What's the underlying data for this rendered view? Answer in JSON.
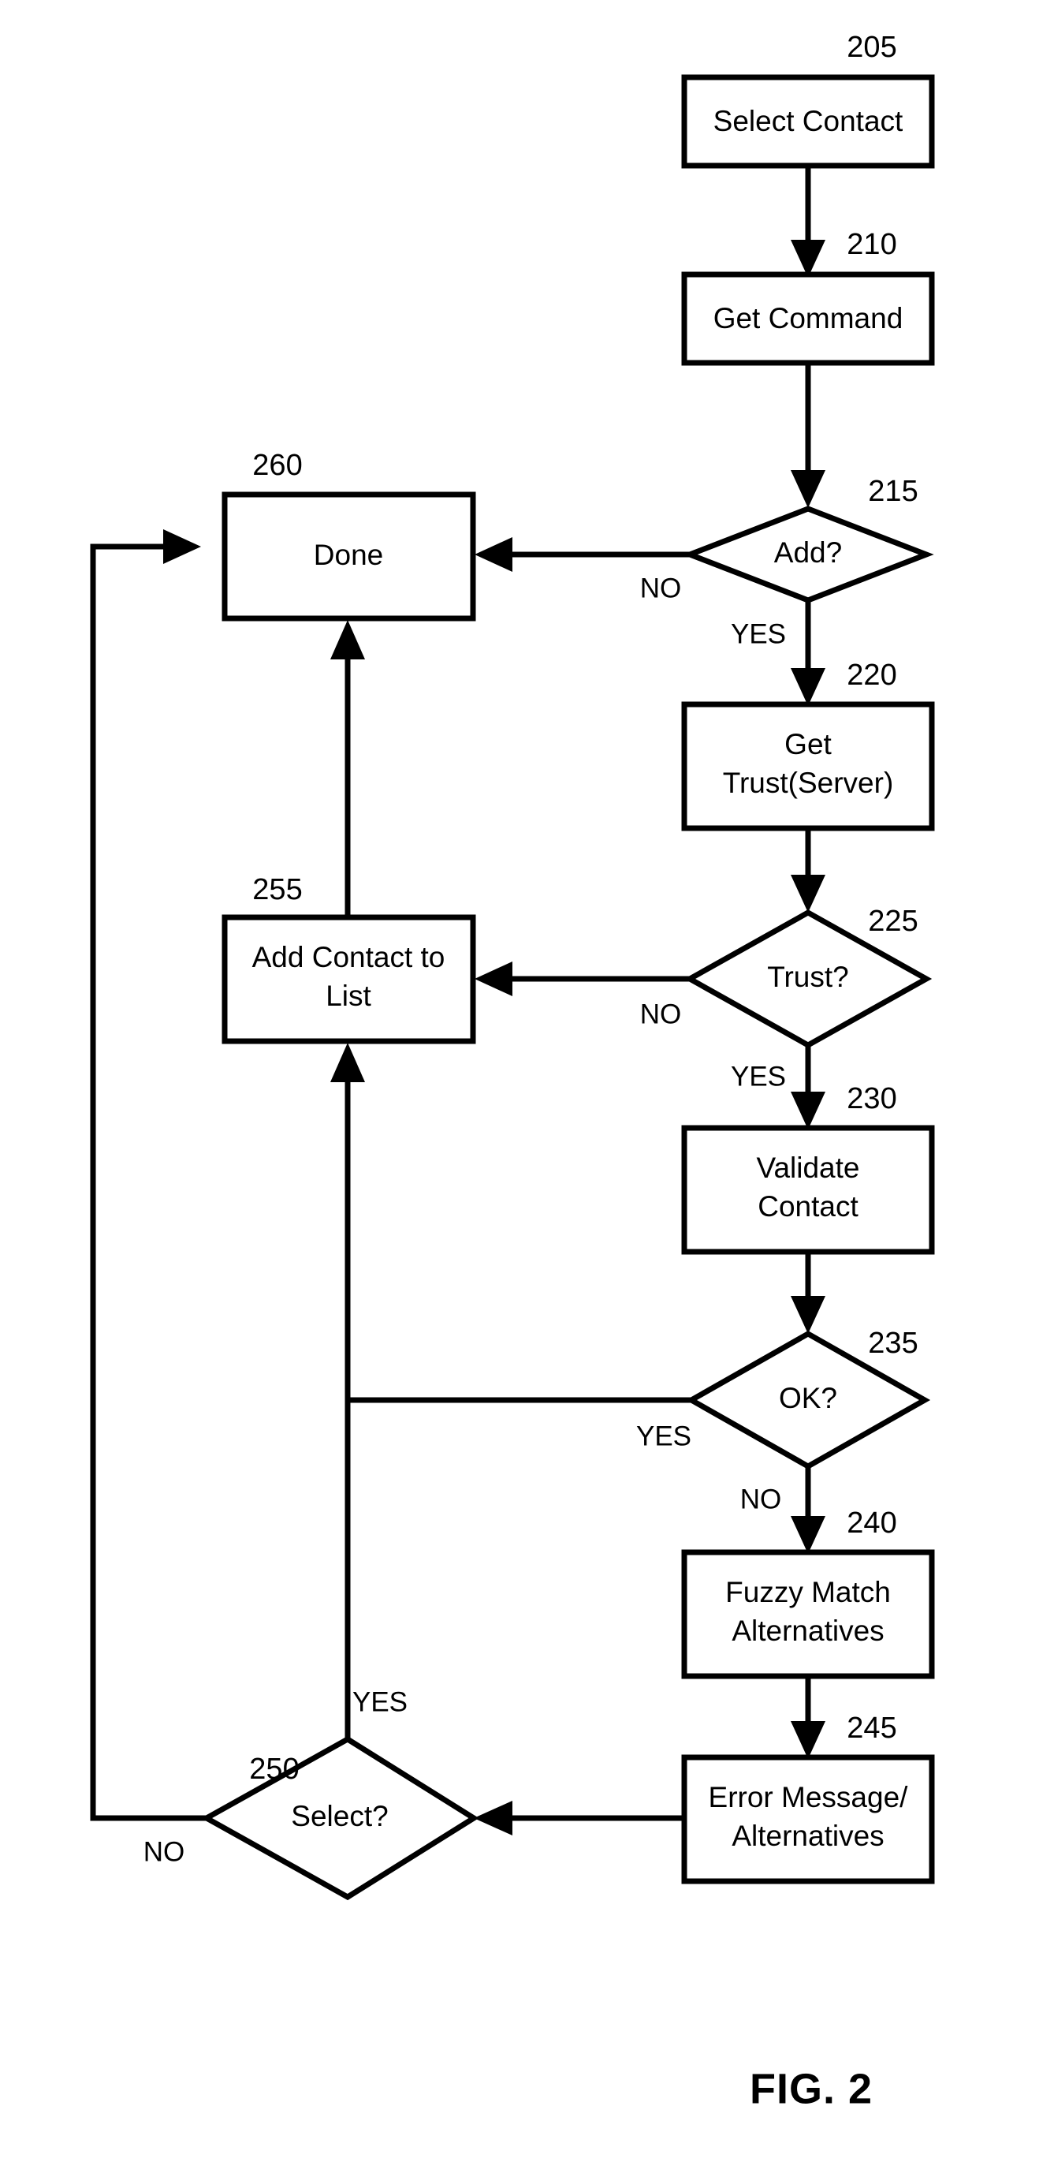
{
  "figure": {
    "caption": "FIG. 2",
    "background_color": "#ffffff",
    "line_color": "#000000"
  },
  "nodes": [
    {
      "ref": "205",
      "shape": "process",
      "label_line1": "Select Contact",
      "label_line2": ""
    },
    {
      "ref": "210",
      "shape": "process",
      "label_line1": "Get Command",
      "label_line2": ""
    },
    {
      "ref": "215",
      "shape": "decision",
      "label_line1": "Add?",
      "label_line2": ""
    },
    {
      "ref": "220",
      "shape": "process",
      "label_line1": "Get",
      "label_line2": "Trust(Server)"
    },
    {
      "ref": "225",
      "shape": "decision",
      "label_line1": "Trust?",
      "label_line2": ""
    },
    {
      "ref": "230",
      "shape": "process",
      "label_line1": "Validate",
      "label_line2": "Contact"
    },
    {
      "ref": "235",
      "shape": "decision",
      "label_line1": "OK?",
      "label_line2": ""
    },
    {
      "ref": "240",
      "shape": "process",
      "label_line1": "Fuzzy Match",
      "label_line2": "Alternatives"
    },
    {
      "ref": "245",
      "shape": "process",
      "label_line1": "Error Message/",
      "label_line2": "Alternatives"
    },
    {
      "ref": "250",
      "shape": "decision",
      "label_line1": "Select?",
      "label_line2": ""
    },
    {
      "ref": "255",
      "shape": "process",
      "label_line1": "Add Contact to",
      "label_line2": "List"
    },
    {
      "ref": "260",
      "shape": "terminal",
      "label_line1": "Done",
      "label_line2": ""
    }
  ],
  "edges": [
    {
      "from": "205",
      "to": "210",
      "label": ""
    },
    {
      "from": "210",
      "to": "215",
      "label": ""
    },
    {
      "from": "215",
      "to": "260",
      "label": "NO"
    },
    {
      "from": "215",
      "to": "220",
      "label": "YES"
    },
    {
      "from": "220",
      "to": "225",
      "label": ""
    },
    {
      "from": "225",
      "to": "255",
      "label": "NO"
    },
    {
      "from": "225",
      "to": "230",
      "label": "YES"
    },
    {
      "from": "230",
      "to": "235",
      "label": ""
    },
    {
      "from": "235",
      "to": "255",
      "label": "YES"
    },
    {
      "from": "235",
      "to": "240",
      "label": "NO"
    },
    {
      "from": "240",
      "to": "245",
      "label": ""
    },
    {
      "from": "245",
      "to": "250",
      "label": ""
    },
    {
      "from": "250",
      "to": "255",
      "label": "YES"
    },
    {
      "from": "250",
      "to": "260",
      "label": "NO"
    },
    {
      "from": "255",
      "to": "260",
      "label": ""
    }
  ],
  "edge_labels": {
    "add_no": "NO",
    "add_yes": "YES",
    "trust_no": "NO",
    "trust_yes": "YES",
    "ok_yes": "YES",
    "ok_no": "NO",
    "select_yes": "YES",
    "select_no": "NO"
  },
  "ref_labels": {
    "n205": "205",
    "n210": "210",
    "n215": "215",
    "n220": "220",
    "n225": "225",
    "n230": "230",
    "n235": "235",
    "n240": "240",
    "n245": "245",
    "n250": "250",
    "n255": "255",
    "n260": "260"
  },
  "node_labels": {
    "n205_l1": "Select Contact",
    "n210_l1": "Get Command",
    "n215_l1": "Add?",
    "n220_l1": "Get",
    "n220_l2": "Trust(Server)",
    "n225_l1": "Trust?",
    "n230_l1": "Validate",
    "n230_l2": "Contact",
    "n235_l1": "OK?",
    "n240_l1": "Fuzzy Match",
    "n240_l2": "Alternatives",
    "n245_l1": "Error Message/",
    "n245_l2": "Alternatives",
    "n250_l1": "Select?",
    "n255_l1": "Add Contact to",
    "n255_l2": "List",
    "n260_l1": "Done"
  }
}
